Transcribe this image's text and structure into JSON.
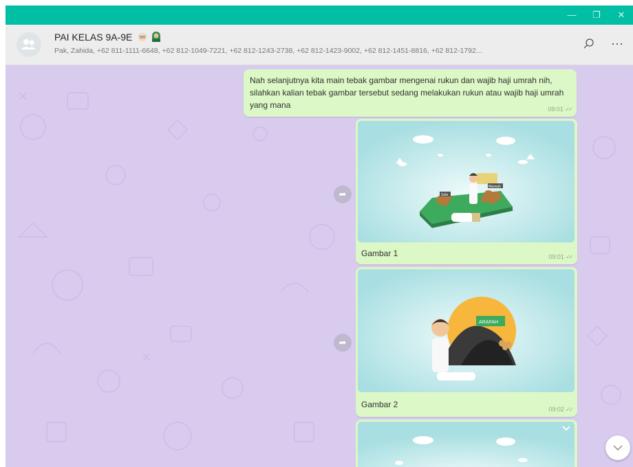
{
  "window": {
    "controls": {
      "minimize": "—",
      "restore": "❐",
      "close": "✕"
    },
    "accent_color": "#00bfa5"
  },
  "header": {
    "avatar_icon": "group-avatar-icon",
    "title": "PAI KELAS 9A-9E",
    "title_emojis": [
      "grandmother-emoji",
      "woman-headscarf-emoji"
    ],
    "subtitle": "Pak, Zahida, +62 811-1111-6648, +62 812-1049-7221, +62 812-1243-2738, +62 812-1423-9002, +62 812-1451-8816, +62 812-1792...",
    "search_icon": "search-icon",
    "menu_icon": "more-options-icon",
    "menu_glyph": "⋯"
  },
  "chat": {
    "wallpaper_color": "#d8cbee",
    "bubble_color": "#dcf8c6",
    "messages": [
      {
        "type": "text",
        "text": "Nah selanjutnya kita main tebak gambar mengenai rukun dan wajib haji umrah nih, silahkan kalian tebak gambar tersebut sedang melakukan rukun atau wajib haji umrah yang mana",
        "time": "09:01",
        "ticks": "✓✓"
      },
      {
        "type": "image",
        "caption": "Gambar 1",
        "time": "09:01",
        "ticks": "✓✓",
        "image_text": [
          "Safa",
          "Marwah"
        ]
      },
      {
        "type": "image",
        "caption": "Gambar 2",
        "time": "09:02",
        "ticks": "✓✓",
        "image_text": [
          "ARAFAH"
        ]
      },
      {
        "type": "image",
        "caption": "",
        "time": "",
        "ticks": ""
      }
    ]
  },
  "controls": {
    "forward_icon": "forward-icon",
    "scroll_down_icon": "chevron-down-icon"
  }
}
